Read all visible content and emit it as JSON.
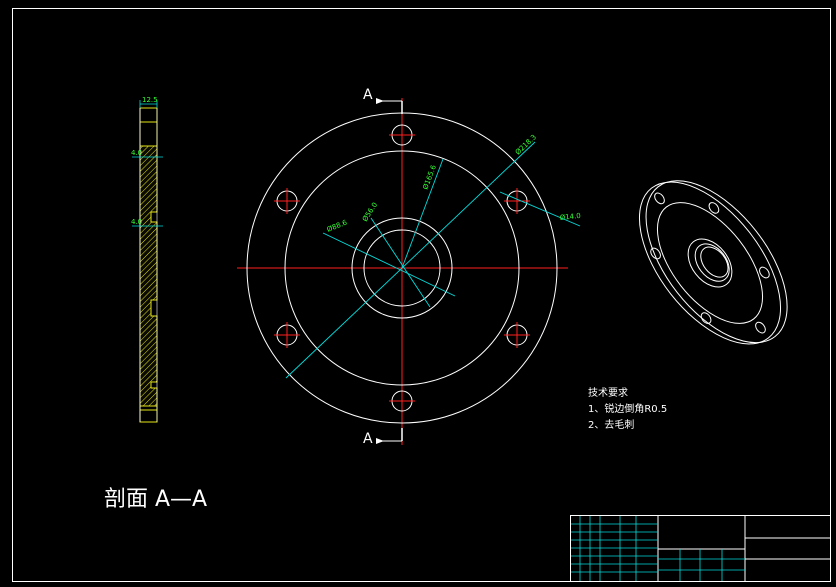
{
  "drawing": {
    "colors": {
      "background": "#000000",
      "outline": "#ffffff",
      "centerline": "#ff2020",
      "dimension": "#00dddd",
      "dim_text": "#33ff33",
      "hatch": "#e6e619"
    },
    "section_view": {
      "title": "剖面 A—A",
      "dims": {
        "thickness": "12.5",
        "step_upper": "4.0",
        "step_lower": "4.0"
      }
    },
    "front_view": {
      "section_marker_top": "A",
      "section_marker_bottom": "A",
      "bolt_hole_count": 6,
      "dims": {
        "outer_dia": "Ø218.3",
        "bolt_circle": "Ø165.6",
        "bore_outer": "Ø88.6",
        "bore_inner": "Ø56.0",
        "hole_dia": "Ø14.0"
      }
    },
    "tech_requirements": {
      "heading": "技术要求",
      "items": [
        "1、锐边倒角R0.5",
        "2、去毛刺"
      ]
    }
  }
}
